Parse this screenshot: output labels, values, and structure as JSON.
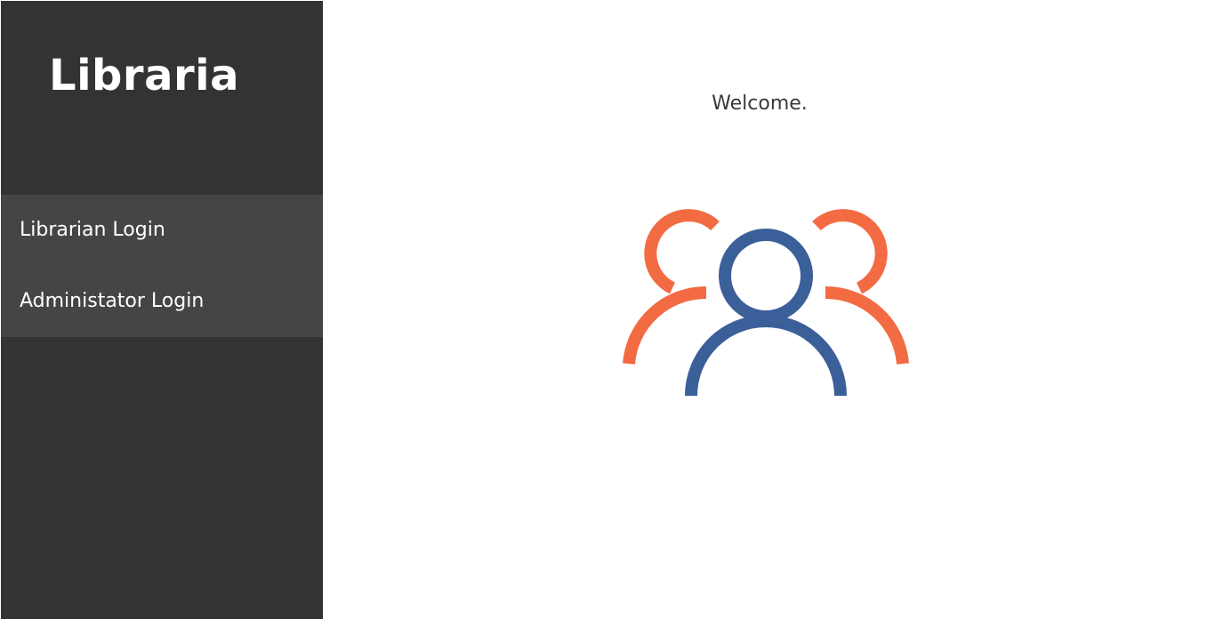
{
  "sidebar": {
    "brand": "Libraria",
    "nav": [
      {
        "label": "Librarian Login"
      },
      {
        "label": "Administator Login"
      }
    ]
  },
  "main": {
    "welcome_text": "Welcome.",
    "illustration": {
      "icon": "users-group-icon",
      "side_figures_color": "#f26b43",
      "center_figure_color": "#3a5f99"
    }
  },
  "colors": {
    "sidebar_bg": "#333333",
    "nav_bg": "#454545",
    "main_bg": "#ffffff",
    "text_light": "#ffffff",
    "text_dark": "#3a3a3a"
  }
}
